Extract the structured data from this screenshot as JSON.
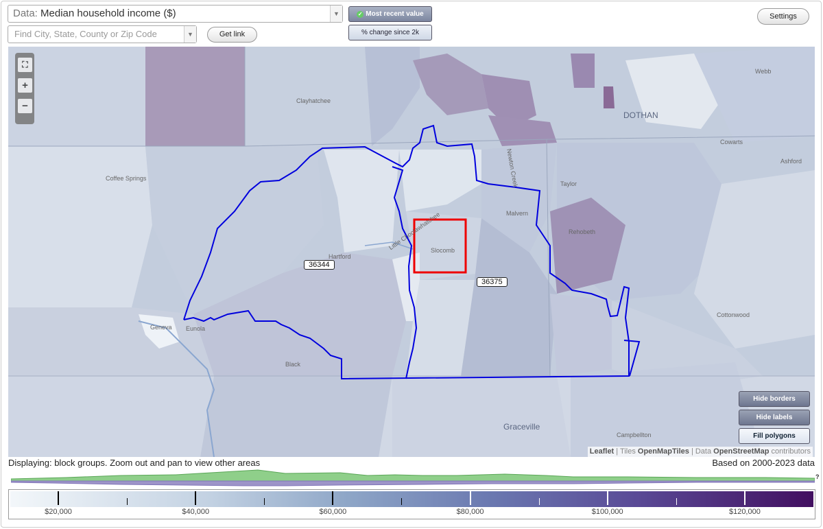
{
  "controls": {
    "data_prefix": "Data:",
    "data_value": "Median household income ($)",
    "search_placeholder": "Find City, State, County or Zip Code",
    "get_link": "Get link",
    "most_recent": "Most recent value",
    "pct_change": "% change since 2k",
    "settings": "Settings"
  },
  "map": {
    "places": {
      "clayhatchee": "Clayhatchee",
      "dothan": "DOTHAN",
      "webb": "Webb",
      "cowarts": "Cowarts",
      "ashford": "Ashford",
      "taylor": "Taylor",
      "coffee_springs": "Coffee Springs",
      "malvern": "Malvern",
      "rehobeth": "Rehobeth",
      "hartford": "Hartford",
      "slocomb": "Slocomb",
      "geneva": "Geneva",
      "eunola": "Eunola",
      "black": "Black",
      "cottonwood": "Cottonwood",
      "graceville": "Graceville",
      "campbellton": "Campbellton",
      "newton_creek": "Newton Creek",
      "little_creek": "Little Choctawhatchee"
    },
    "zips": [
      "36344",
      "36375"
    ],
    "buttons": {
      "hide_borders": "Hide borders",
      "hide_labels": "Hide labels",
      "fill_polygons": "Fill polygons"
    },
    "attribution": {
      "leaflet": "Leaflet",
      "tiles_prefix": "| Tiles",
      "tiles": "OpenMapTiles",
      "data_prefix": "| Data",
      "data": "OpenStreetMap",
      "suffix": "contributors"
    }
  },
  "status": {
    "displaying": "Displaying: block groups. Zoom out and pan to view other areas",
    "based_on": "Based on 2000-2023 data"
  },
  "legend": {
    "min": 13000,
    "max": 130000,
    "ticks": [
      {
        "value": 20000,
        "label": "$20,000"
      },
      {
        "value": 40000,
        "label": "$40,000"
      },
      {
        "value": 60000,
        "label": "$60,000"
      },
      {
        "value": 80000,
        "label": "$80,000"
      },
      {
        "value": 100000,
        "label": "$100,000"
      },
      {
        "value": 120000,
        "label": "$120,000"
      }
    ],
    "minor_ticks": [
      30000,
      50000,
      70000,
      90000,
      110000
    ],
    "colors": {
      "low": "#f3f7fa",
      "high": "#420f60",
      "zip_border": "#0000dd",
      "selected": "#ee0000"
    }
  }
}
